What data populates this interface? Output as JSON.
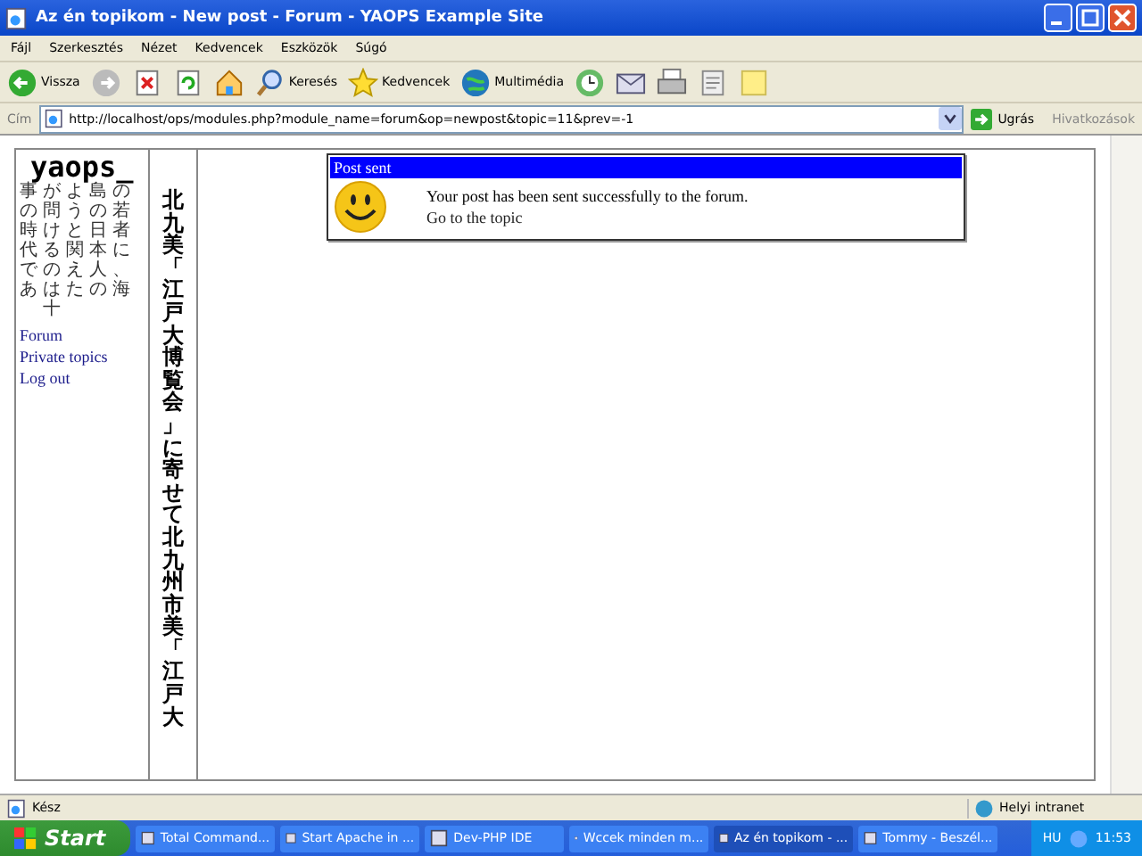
{
  "window": {
    "title": "Az én topikom - New post - Forum - YAOPS Example Site"
  },
  "menu": [
    "Fájl",
    "Szerkesztés",
    "Nézet",
    "Kedvencek",
    "Eszközök",
    "Súgó"
  ],
  "toolbar": [
    {
      "kind": "back",
      "label": "Vissza"
    },
    {
      "kind": "forward"
    },
    {
      "kind": "stop"
    },
    {
      "kind": "refresh"
    },
    {
      "kind": "home"
    },
    {
      "kind": "search",
      "label": "Keresés"
    },
    {
      "kind": "favorites",
      "label": "Kedvencek"
    },
    {
      "kind": "media",
      "label": "Multimédia"
    },
    {
      "kind": "history"
    },
    {
      "kind": "mail"
    },
    {
      "kind": "print"
    },
    {
      "kind": "edit"
    },
    {
      "kind": "note"
    }
  ],
  "address_bar": {
    "label": "Cím",
    "value": "http://localhost/ops/modules.php?module_name=forum&op=newpost&topic=11&prev=-1",
    "go": "Ugrás",
    "links": "Hivatkozások"
  },
  "sidebar": {
    "logo": "yaops_",
    "vertical_columns": [
      "事の時代であ",
      "が問けるのは十",
      "ようと関えた",
      "島の日本人の",
      "の若者に、海"
    ],
    "links": [
      "Forum",
      "Private topics",
      "Log out"
    ]
  },
  "banner_text": "北九美「江戸大博覧会」に寄せて北九州市美「江戸大",
  "message": {
    "title": "Post sent",
    "text": "Your post has been sent successfully to the forum.",
    "link": "Go to the topic"
  },
  "status_bar": {
    "text": "Kész",
    "zone": "Helyi intranet"
  },
  "taskbar": {
    "start": "Start",
    "tasks": [
      {
        "label": "Total Command...",
        "selected": false
      },
      {
        "label": "Start Apache in ...",
        "selected": false
      },
      {
        "label": "Dev-PHP IDE",
        "selected": false
      },
      {
        "label": "Wccek minden m...",
        "selected": false
      },
      {
        "label": "Az én topikom - ...",
        "selected": true
      },
      {
        "label": "Tommy - Beszél...",
        "selected": false
      }
    ],
    "language": "HU",
    "clock": "11:53"
  }
}
